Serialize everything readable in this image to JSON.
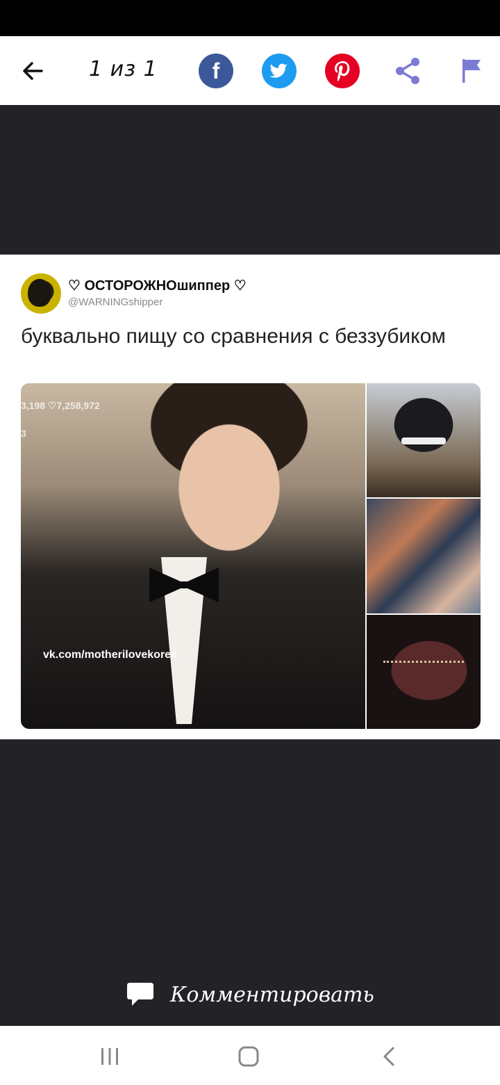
{
  "top_bar": {
    "counter": "1 из 1",
    "share_buttons": [
      "facebook",
      "twitter",
      "pinterest",
      "share",
      "report-flag"
    ],
    "colors": {
      "facebook": "#3b5998",
      "twitter": "#1d9bf0",
      "pinterest": "#e60023",
      "share": "#7b7bd6",
      "flag": "#7b7bd6"
    }
  },
  "post": {
    "display_name": "♡ ОСТОРОЖНОшиппер ♡",
    "handle": "@WARNINGshipper",
    "text": "буквально пищу со сравнения с беззубиком",
    "media": {
      "stats_line": "3,198 ♡7,258,972",
      "stats_sub": "3",
      "watermark": "vk.com/motherilovekorea"
    }
  },
  "comment": {
    "label": "Комментировать"
  },
  "nav": {
    "buttons": [
      "recent-apps",
      "home",
      "back"
    ]
  }
}
